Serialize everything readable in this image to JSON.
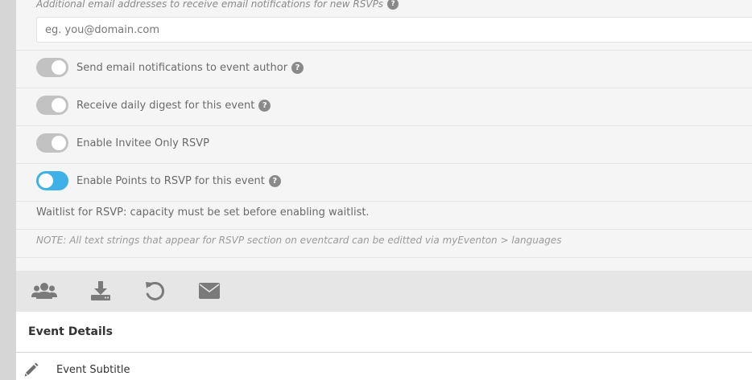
{
  "rsvp_settings": {
    "additional_emails": {
      "label": "Additional email addresses to receive email notifications for new RSVPs",
      "help": "?",
      "placeholder": "eg. you@domain.com",
      "value": ""
    },
    "toggles": [
      {
        "label": "Send email notifications to event author",
        "state": "off",
        "help": "?"
      },
      {
        "label": "Receive daily digest for this event",
        "state": "off",
        "help": "?"
      },
      {
        "label": "Enable Invitee Only RSVP",
        "state": "off"
      },
      {
        "label": "Enable Points to RSVP for this event",
        "state": "on",
        "help": "?"
      }
    ],
    "waitlist_text": "Waitlist for RSVP: capacity must be set before enabling waitlist.",
    "note_text": "NOTE: All text strings that appear for RSVP section on eventcard can be editted via myEventon > languages"
  },
  "toolbar": {
    "icons": [
      "users-icon",
      "download-icon",
      "undo-icon",
      "envelope-icon"
    ]
  },
  "event_details": {
    "title": "Event Details",
    "subtitle_label": "Event Subtitle"
  },
  "colors": {
    "toggle_off": "#c2c2c2",
    "toggle_on": "#3eb1e6",
    "panel_bg": "#f5f5f5",
    "toolbar_bg": "#e6e6e6",
    "icon_gray": "#7a7a7a"
  }
}
